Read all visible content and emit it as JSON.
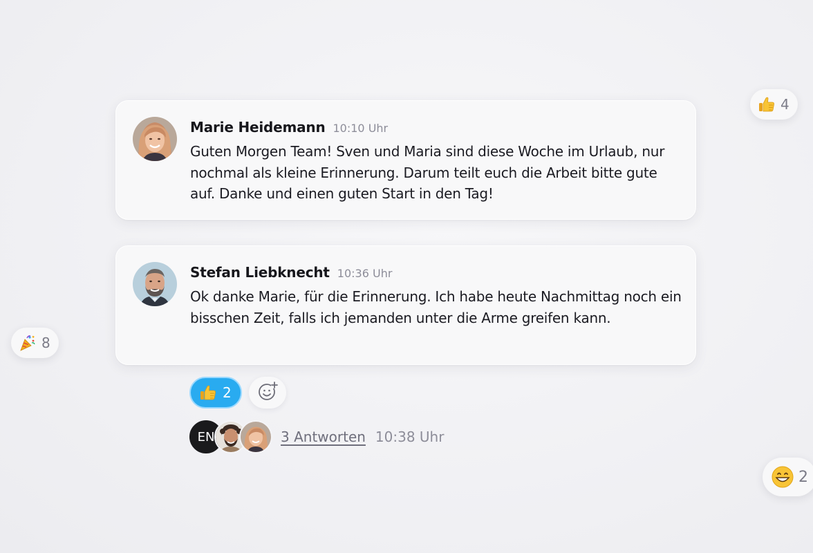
{
  "messages": [
    {
      "author": "Marie Heidemann",
      "time": "10:10 Uhr",
      "text": "Guten Morgen Team! Sven und Maria sind diese Woche im Urlaub, nur nochmal als kleine Erinnerung. Darum teilt euch die Arbeit bitte gute auf. Danke und einen guten Start in den Tag!",
      "avatar": "avatar-woman-blonde"
    },
    {
      "author": "Stefan Liebknecht",
      "time": "10:36 Uhr",
      "text": "Ok danke Marie, für die Erinnerung. Ich habe heute Nachmittag noch ein bisschen Zeit, falls ich jemanden unter die Arme greifen kann.",
      "avatar": "avatar-man-beard"
    }
  ],
  "reactions": [
    {
      "icon": "thumbs-up-icon",
      "count": "2",
      "active": true
    }
  ],
  "add_reaction_icon": "add-emoji-icon",
  "thread": {
    "participants": [
      {
        "initials": "EN"
      },
      {
        "avatar": "avatar-man-curly"
      },
      {
        "avatar": "avatar-woman-blonde"
      }
    ],
    "replies_label": "3 Antworten",
    "last_reply_time": "10:38 Uhr"
  },
  "floating_reactions": [
    {
      "icon": "thumbs-up-icon",
      "count": "4"
    },
    {
      "icon": "party-popper-icon",
      "count": "8"
    },
    {
      "icon": "grinning-face-icon",
      "count": "2"
    }
  ],
  "colors": {
    "accent": "#29abf0",
    "background": "#f1f1f4",
    "card": "#f8f8f9",
    "muted_text": "#8d8d99"
  }
}
